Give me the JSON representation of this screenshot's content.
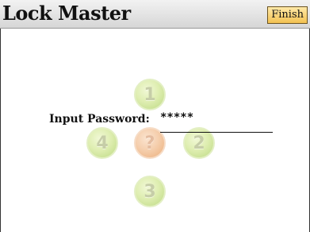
{
  "header": {
    "title": "Lock Master",
    "finish_label": "Finish"
  },
  "password": {
    "label": "Input Password:",
    "value": "*****"
  },
  "keypad": {
    "up": "1",
    "right": "2",
    "down": "3",
    "left": "4",
    "center": "?"
  },
  "colors": {
    "header_bg": "#d6d6d6",
    "finish_button": "#f3c252",
    "keypad_green": "#c9e194",
    "keypad_orange": "#efba8d"
  }
}
